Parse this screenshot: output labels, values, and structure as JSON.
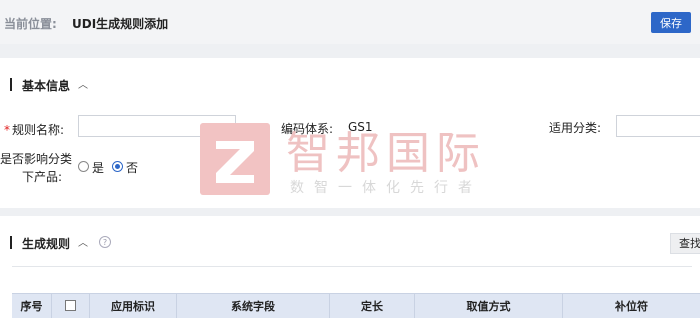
{
  "header": {
    "crumb_label": "当前位置:",
    "page_title": "UDI生成规则添加",
    "save_label": "保存"
  },
  "basic": {
    "title": "基本信息",
    "rule_name_label": "规则名称:",
    "rule_name_value": "",
    "code_system_label": "编码体系:",
    "code_system_value": "GS1",
    "category_label": "适用分类:",
    "category_value": "",
    "affects_label_line1": "是否影响分类",
    "affects_label_line2": "下产品:",
    "opt_yes": "是",
    "opt_no": "否",
    "selected": "否"
  },
  "rules": {
    "title": "生成规则",
    "find_label": "查找",
    "columns": [
      "序号",
      "应用标识",
      "系统字段",
      "定长",
      "取值方式",
      "补位符"
    ]
  },
  "watermark": {
    "brand": "智邦国际",
    "slogan": "数智一体化先行者"
  },
  "colors": {
    "primary": "#2d67c8",
    "required": "#e02020",
    "table_header": "#dfe6f3"
  }
}
